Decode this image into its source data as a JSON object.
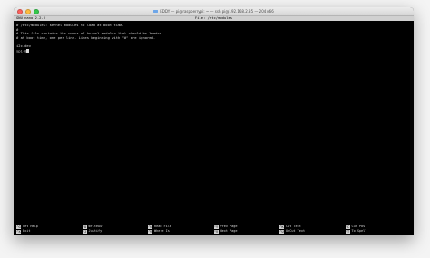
{
  "window": {
    "title": "EDDY — pi@raspberrypi: ~ — ssh pi@192.168.2.35 — 204×66"
  },
  "nano": {
    "version": "GNU nano 2.2.6",
    "file": "File: /etc/modules"
  },
  "content_lines": [
    "# /etc/modules: kernel modules to load at boot time.",
    "#",
    "# This file contains the names of kernel modules that should be loaded",
    "# at boot time, one per line. Lines beginning with \"#\" are ignored.",
    "",
    "i2c-dev",
    "spi-0"
  ],
  "shortcuts": [
    {
      "key": "^G",
      "label": "Get Help"
    },
    {
      "key": "^O",
      "label": "WriteOut"
    },
    {
      "key": "^R",
      "label": "Read File"
    },
    {
      "key": "^Y",
      "label": "Prev Page"
    },
    {
      "key": "^K",
      "label": "Cut Text"
    },
    {
      "key": "^C",
      "label": "Cur Pos"
    },
    {
      "key": "^X",
      "label": "Exit"
    },
    {
      "key": "^J",
      "label": "Justify"
    },
    {
      "key": "^W",
      "label": "Where Is"
    },
    {
      "key": "^V",
      "label": "Next Page"
    },
    {
      "key": "^U",
      "label": "UnCut Text"
    },
    {
      "key": "^T",
      "label": "To Spell"
    }
  ],
  "colors": {
    "terminal_bg": "#000000",
    "terminal_fg": "#d8d8d8",
    "inverse_bg": "#d0d0d0"
  }
}
